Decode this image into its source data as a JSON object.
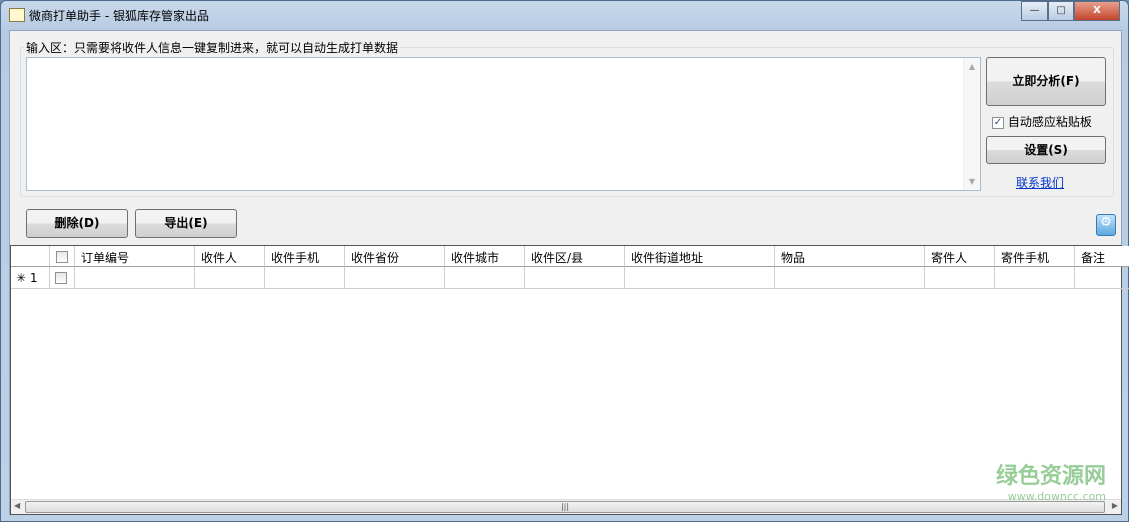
{
  "window": {
    "title": "微商打单助手 - 银狐库存管家出品",
    "minimize": "—",
    "maximize": "□",
    "close": "X"
  },
  "input": {
    "label": "输入区：只需要将收件人信息一键复制进来，就可以自动生成打单数据",
    "value": ""
  },
  "side": {
    "analyze": "立即分析(F)",
    "auto_paste": "自动感应粘贴板",
    "auto_paste_checked": true,
    "settings": "设置(S)",
    "contact": "联系我们"
  },
  "toolbar": {
    "delete": "删除(D)",
    "export": "导出(E)"
  },
  "grid": {
    "columns": [
      "订单编号",
      "收件人",
      "收件手机",
      "收件省份",
      "收件城市",
      "收件区/县",
      "收件街道地址",
      "物品",
      "寄件人",
      "寄件手机",
      "备注"
    ],
    "rows": [
      {
        "marker": "✳",
        "index": "1"
      }
    ]
  },
  "watermark": {
    "name": "绿色资源网",
    "url": "www.downcc.com"
  }
}
